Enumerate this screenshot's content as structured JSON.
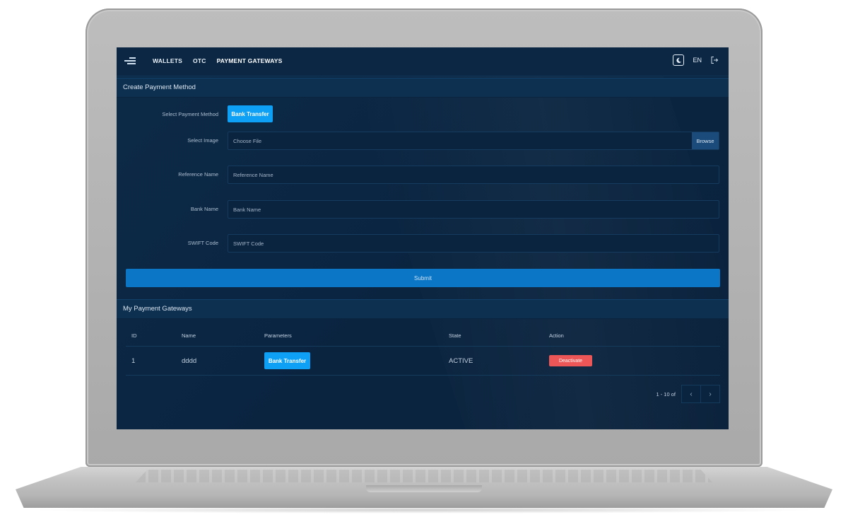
{
  "nav": {
    "items": [
      "WALLETS",
      "OTC",
      "PAYMENT GATEWAYS"
    ],
    "active": "PAYMENT GATEWAYS",
    "lang": "EN",
    "icons": {
      "menu": "menu-icon",
      "theme": "moon-icon",
      "logout": "logout-icon"
    }
  },
  "create": {
    "title": "Create Payment Method",
    "method_label": "Select Payment Method",
    "method_button": "Bank Transfer",
    "image_label": "Select Image",
    "image_placeholder": "Choose File",
    "browse": "Browse",
    "ref_label": "Reference Name",
    "ref_placeholder": "Reference Name",
    "bank_label": "Bank Name",
    "bank_placeholder": "Bank Name",
    "swift_label": "SWIFT Code",
    "swift_placeholder": "SWIFT Code",
    "submit": "Submit"
  },
  "gateways": {
    "title": "My Payment Gateways",
    "columns": [
      "ID",
      "Name",
      "Parameters",
      "State",
      "Action"
    ],
    "rows": [
      {
        "id": "1",
        "name": "dddd",
        "parameter": "Bank Transfer",
        "state": "ACTIVE",
        "action": "Deactivate"
      }
    ],
    "pager_info": "1 - 10 of",
    "prev": "‹",
    "next": "›"
  },
  "colors": {
    "accent": "#0ea0f5",
    "submit": "#0b76c6",
    "danger": "#ec5656",
    "background": "#0a2440"
  }
}
